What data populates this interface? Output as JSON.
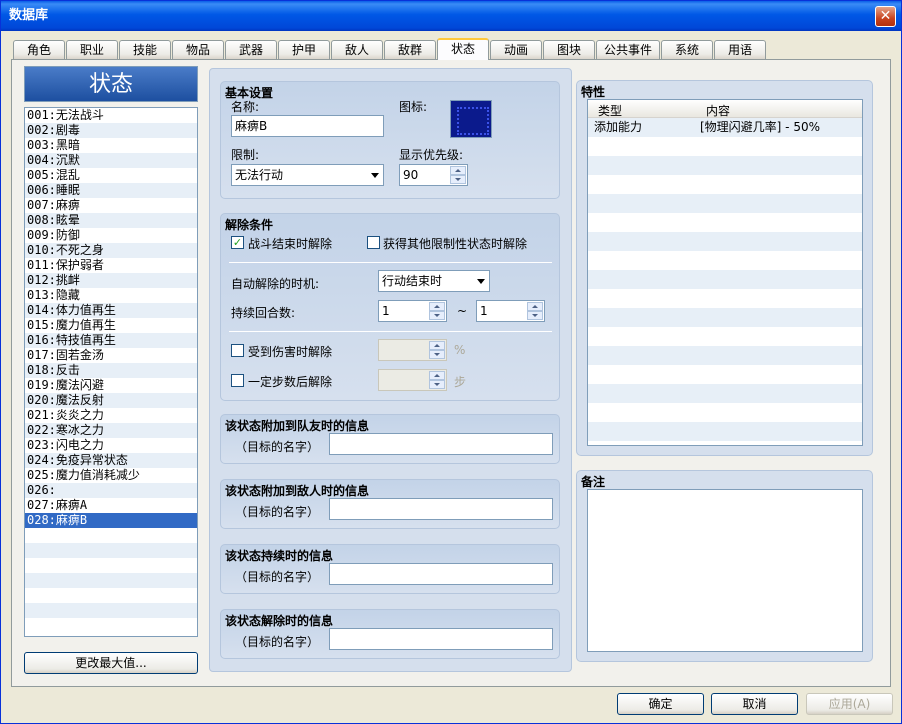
{
  "window": {
    "title": "数据库"
  },
  "tabs": [
    "角色",
    "职业",
    "技能",
    "物品",
    "武器",
    "护甲",
    "敌人",
    "敌群",
    "状态",
    "动画",
    "图块",
    "公共事件",
    "系统",
    "用语"
  ],
  "active_tab": "状态",
  "list": {
    "header": "状态",
    "items": [
      "001:无法战斗",
      "002:剧毒",
      "003:黑暗",
      "004:沉默",
      "005:混乱",
      "006:睡眠",
      "007:麻痹",
      "008:眩晕",
      "009:防御",
      "010:不死之身",
      "011:保护弱者",
      "012:挑衅",
      "013:隐藏",
      "014:体力值再生",
      "015:魔力值再生",
      "016:特技值再生",
      "017:固若金汤",
      "018:反击",
      "019:魔法闪避",
      "020:魔法反射",
      "021:炎炎之力",
      "022:寒冰之力",
      "023:闪电之力",
      "024:免疫异常状态",
      "025:魔力值消耗减少",
      "026:",
      "027:麻痹A",
      "028:麻痹B"
    ],
    "selected_index": 27,
    "change_max_button": "更改最大值..."
  },
  "basic": {
    "title": "基本设置",
    "name_label": "名称:",
    "name_value": "麻痹B",
    "icon_label": "图标:",
    "restriction_label": "限制:",
    "restriction_value": "无法行动",
    "priority_label": "显示优先级:",
    "priority_value": "90"
  },
  "removal": {
    "title": "解除条件",
    "remove_at_battle_end": "战斗结束时解除",
    "remove_at_battle_end_checked": true,
    "remove_by_restriction": "获得其他限制性状态时解除",
    "remove_by_restriction_checked": false,
    "auto_removal_label": "自动解除的时机:",
    "auto_removal_value": "行动结束时",
    "duration_label": "持续回合数:",
    "duration_min": "1",
    "tilde": "~",
    "duration_max": "1",
    "remove_by_damage": "受到伤害时解除",
    "damage_unit": "%",
    "remove_by_walking": "一定步数后解除",
    "steps_unit": "步"
  },
  "messages": [
    {
      "title": "该状态附加到队友时的信息",
      "prefix": "（目标的名字）",
      "value": ""
    },
    {
      "title": "该状态附加到敌人时的信息",
      "prefix": "（目标的名字）",
      "value": ""
    },
    {
      "title": "该状态持续时的信息",
      "prefix": "（目标的名字）",
      "value": ""
    },
    {
      "title": "该状态解除时的信息",
      "prefix": "（目标的名字）",
      "value": ""
    }
  ],
  "traits": {
    "title": "特性",
    "col_type": "类型",
    "col_content": "内容",
    "rows": [
      {
        "type": "添加能力",
        "content": "[物理闪避几率] - 50%"
      }
    ]
  },
  "note": {
    "title": "备注",
    "value": ""
  },
  "footer": {
    "ok": "确定",
    "cancel": "取消",
    "apply": "应用(A)"
  },
  "colors": {
    "selection": "#316ac5",
    "titlebar": "#0058e6",
    "panel": "#d5dfed"
  }
}
